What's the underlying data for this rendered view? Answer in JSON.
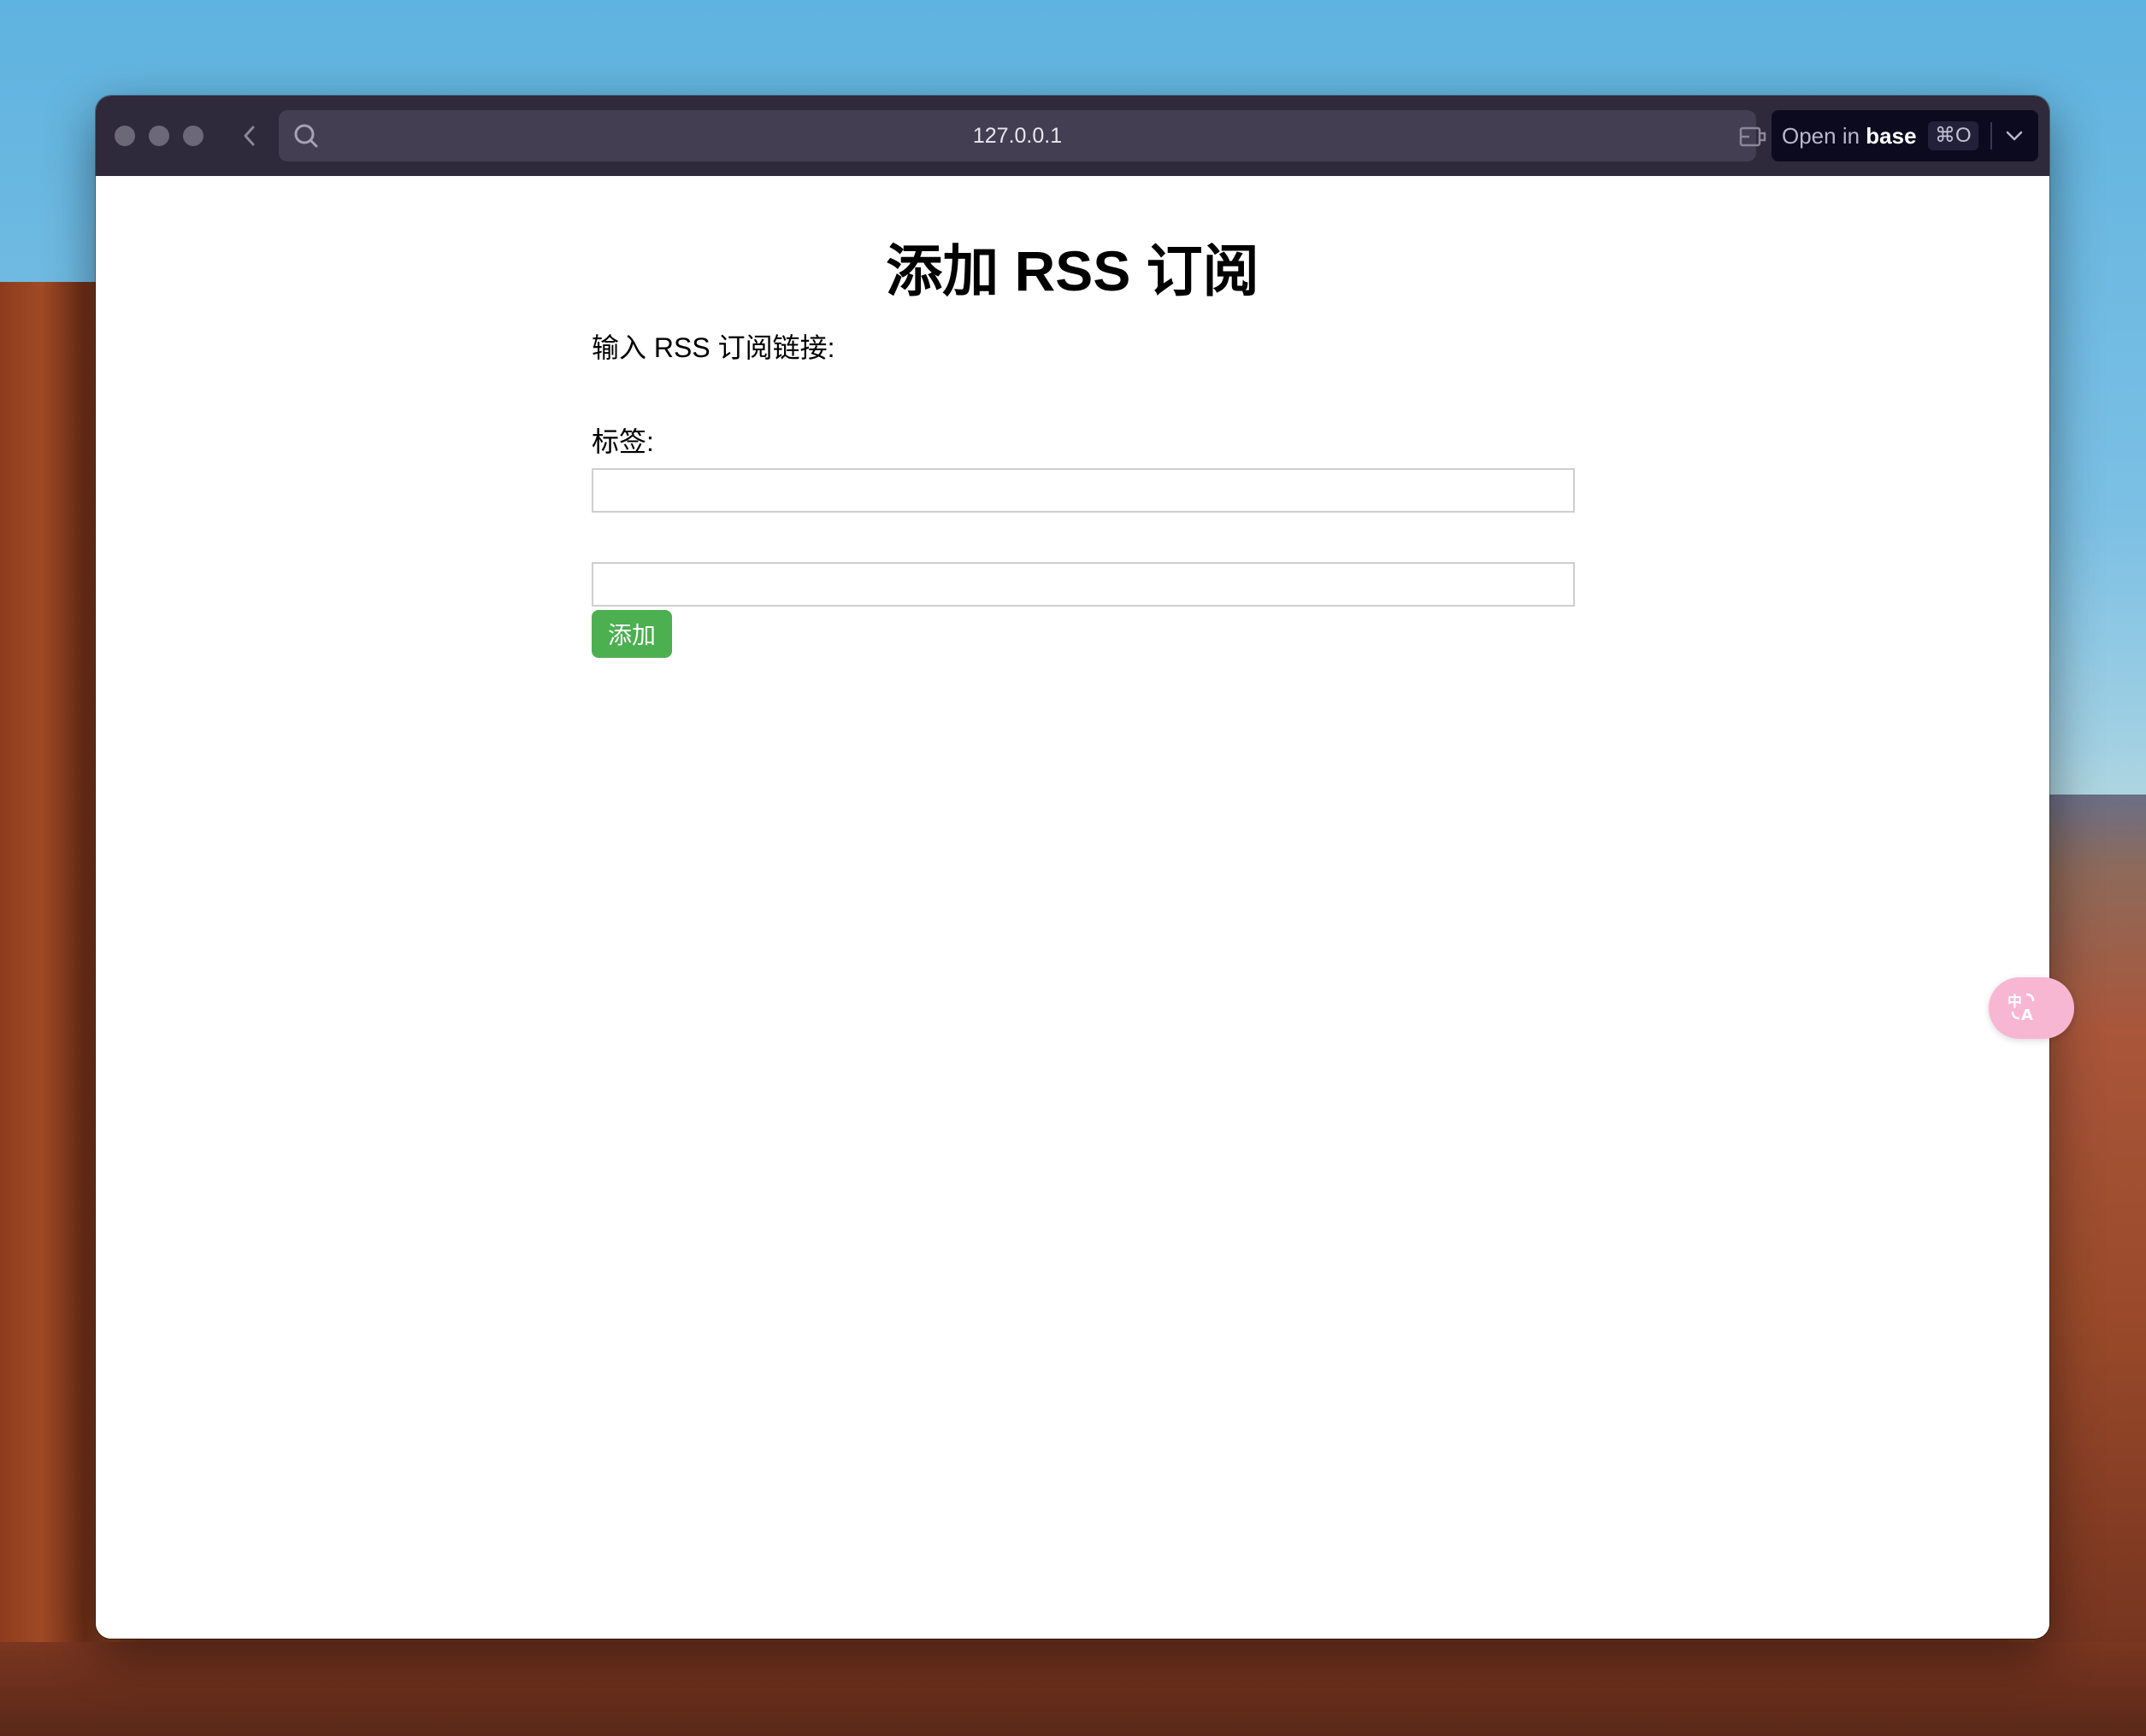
{
  "browser": {
    "url": "127.0.0.1",
    "open_in": {
      "prefix": "Open in ",
      "app": "base",
      "shortcut": "⌘O"
    }
  },
  "page": {
    "title": "添加 RSS 订阅",
    "form": {
      "url_label": "输入 RSS 订阅链接:",
      "url_value": "",
      "tag_label": "标签:",
      "tag_value": "",
      "submit_label": "添加"
    }
  },
  "colors": {
    "submit_button": "#4caf50",
    "translate_fab": "#f7b6d2",
    "titlebar": "#2e2a3b"
  },
  "icons": {
    "back": "chevron-left-icon",
    "search": "search-icon",
    "cast": "cast-icon",
    "link": "link-icon",
    "dropdown": "chevron-down-icon",
    "translate": "translate-icon"
  }
}
